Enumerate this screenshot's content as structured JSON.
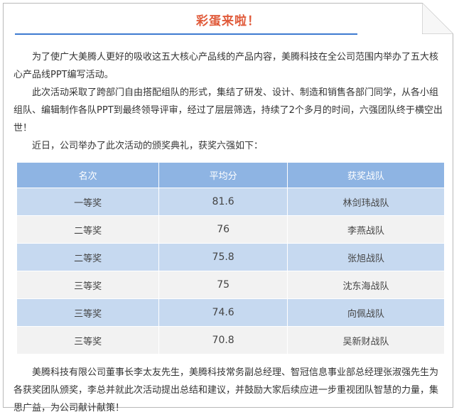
{
  "title": "彩蛋来啦！",
  "paragraphs": {
    "p1": "为了使广大美腾人更好的吸收这五大核心产品线的产品内容，美腾科技在全公司范围内举办了五大核心产品线PPT编写活动。",
    "p2": "此次活动采取了跨部门自由搭配组队的形式，集结了研发、设计、制造和销售各部门同学，从各小组组队、编辑制作各队PPT到最终领导评审，经过了层层筛选，持续了2个多月的时间，六强团队终于横空出世！",
    "p3": "近日，公司举办了此次活动的颁奖典礼，获奖六强如下：",
    "p4": "美腾科技有限公司董事长李太友先生，美腾科技常务副总经理、智冠信息事业部总经理张淑强先生为各获奖团队颁奖，李总并就此次活动提出总结和建议，并鼓励大家后续应进一步重视团队智慧的力量，集思广益，为公司献计献策！"
  },
  "table": {
    "headers": [
      "名次",
      "平均分",
      "获奖战队"
    ],
    "rows": [
      {
        "rank": "一等奖",
        "score": "81.6",
        "team": "林剑玮战队"
      },
      {
        "rank": "二等奖",
        "score": "76",
        "team": "李燕战队"
      },
      {
        "rank": "二等奖",
        "score": "75.8",
        "team": "张旭战队"
      },
      {
        "rank": "三等奖",
        "score": "75",
        "team": "沈东海战队"
      },
      {
        "rank": "三等奖",
        "score": "74.6",
        "team": "向佩战队"
      },
      {
        "rank": "三等奖",
        "score": "70.8",
        "team": "吴新财战队"
      }
    ]
  },
  "colors": {
    "title": "#e05a3a",
    "rule": "#3d7bd0",
    "header_bg": "#8eb4e3",
    "row_blue": "#c6d9f0",
    "row_gray": "#f2f2f2"
  }
}
